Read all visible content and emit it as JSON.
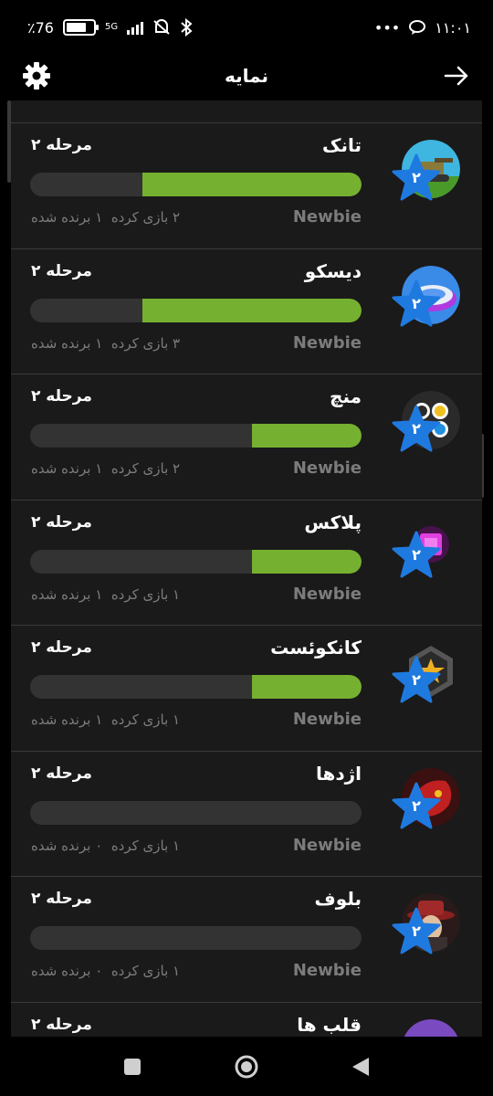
{
  "status_bar": {
    "battery": "٪76",
    "network": "5G",
    "time": "۱۱:۰۱",
    "dots": "•••"
  },
  "header": {
    "title": "نمایه"
  },
  "games": [
    {
      "name": "تانک",
      "stage": "مرحله ۲",
      "rank": "Newbie",
      "played": "۲ بازی کرده",
      "won": "۱ برنده شده",
      "level": "۲",
      "progress": 0.66,
      "icon": "tank-icon"
    },
    {
      "name": "دیسکو",
      "stage": "مرحله ۲",
      "rank": "Newbie",
      "played": "۳ بازی کرده",
      "won": "۱ برنده شده",
      "level": "۲",
      "progress": 0.66,
      "icon": "disco-icon"
    },
    {
      "name": "منچ",
      "stage": "مرحله ۲",
      "rank": "Newbie",
      "played": "۲ بازی کرده",
      "won": "۱ برنده شده",
      "level": "۲",
      "progress": 0.33,
      "icon": "ludo-icon"
    },
    {
      "name": "پلاکس",
      "stage": "مرحله ۲",
      "rank": "Newbie",
      "played": "۱ بازی کرده",
      "won": "۱ برنده شده",
      "level": "۲",
      "progress": 0.33,
      "icon": "plax-icon"
    },
    {
      "name": "کانکوئست",
      "stage": "مرحله ۲",
      "rank": "Newbie",
      "played": "۱ بازی کرده",
      "won": "۱ برنده شده",
      "level": "۲",
      "progress": 0.33,
      "icon": "conquest-icon"
    },
    {
      "name": "اژدها",
      "stage": "مرحله ۲",
      "rank": "Newbie",
      "played": "۱ بازی کرده",
      "won": "۰ برنده شده",
      "level": "۲",
      "progress": 0,
      "icon": "dragon-icon"
    },
    {
      "name": "بلوف",
      "stage": "مرحله ۲",
      "rank": "Newbie",
      "played": "۱ بازی کرده",
      "won": "۰ برنده شده",
      "level": "۲",
      "progress": 0,
      "icon": "bluff-icon"
    },
    {
      "name": "قلب ها",
      "stage": "مرحله ۲",
      "rank": "",
      "played": "",
      "won": "",
      "level": "",
      "progress": 0,
      "icon": "hearts-icon"
    }
  ],
  "colors": {
    "progress_fill": "#76b030",
    "progress_track": "#333333",
    "star": "#1f7ae0",
    "card_bg": "#1a1a1a",
    "muted_text": "#7c7c7c"
  },
  "navigation": {
    "icons": [
      "recents-square-icon",
      "home-circle-icon",
      "back-triangle-icon"
    ]
  }
}
